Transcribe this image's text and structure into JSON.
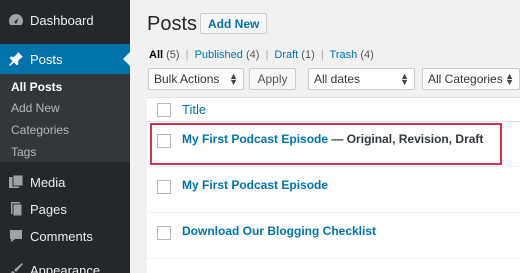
{
  "sidebar": {
    "dashboard": "Dashboard",
    "posts": "Posts",
    "submenu": [
      "All Posts",
      "Add New",
      "Categories",
      "Tags"
    ],
    "media": "Media",
    "pages": "Pages",
    "comments": "Comments",
    "appearance": "Appearance"
  },
  "header": {
    "title": "Posts",
    "add_new": "Add New"
  },
  "status": {
    "all": "All",
    "all_count": "(5)",
    "published": "Published",
    "published_count": "(4)",
    "draft": "Draft",
    "draft_count": "(1)",
    "trash": "Trash",
    "trash_count": "(4)",
    "separator": "|"
  },
  "filters": {
    "bulk_actions": "Bulk Actions",
    "apply": "Apply",
    "dates": "All dates",
    "categories": "All Categories"
  },
  "table": {
    "title_header": "Title",
    "rows": [
      {
        "title": "My First Podcast Episode",
        "state": "— Original, Revision, Draft"
      },
      {
        "title": "My First Podcast Episode",
        "state": ""
      },
      {
        "title": "Download Our Blogging Checklist",
        "state": ""
      }
    ]
  },
  "colors": {
    "accent": "#0073aa",
    "sidebar": "#23282d",
    "highlight": "#d0344f"
  }
}
